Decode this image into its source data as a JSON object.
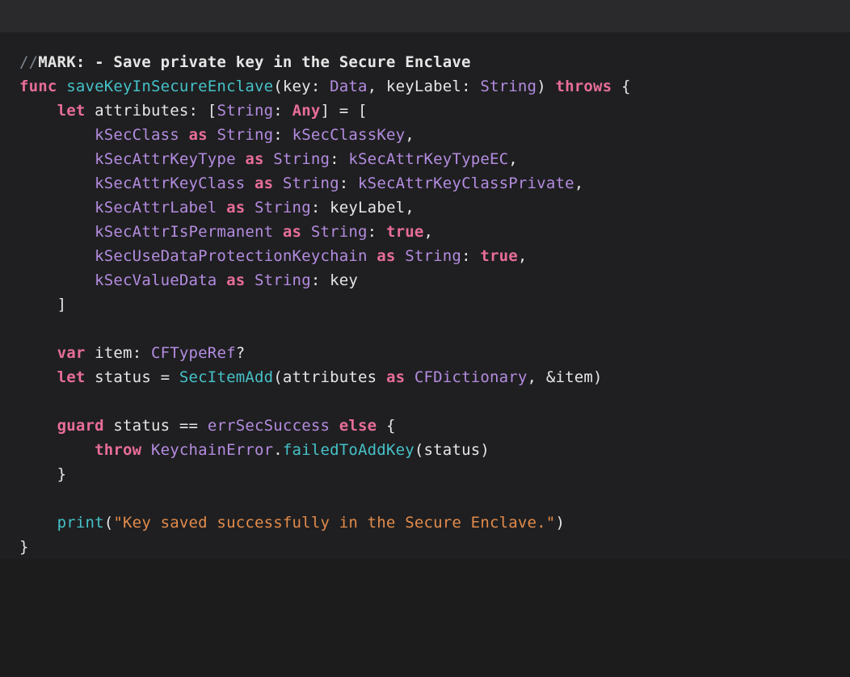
{
  "comment_prefix": "//",
  "comment_mark": "MARK: - Save private key in the Secure Enclave",
  "sig": {
    "func_kw": "func",
    "name": "saveKeyInSecureEnclave",
    "p1_name": "key",
    "p1_type": "Data",
    "p2_name": "keyLabel",
    "p2_type": "String",
    "throws_kw": "throws"
  },
  "attr": {
    "let_kw": "let",
    "var_name": "attributes",
    "dict_key_type": "String",
    "dict_val_type": "Any",
    "l1_k": "kSecClass",
    "l1_v": "kSecClassKey",
    "l2_k": "kSecAttrKeyType",
    "l2_v": "kSecAttrKeyTypeEC",
    "l3_k": "kSecAttrKeyClass",
    "l3_v": "kSecAttrKeyClassPrivate",
    "l4_k": "kSecAttrLabel",
    "l4_v": "keyLabel",
    "l5_k": "kSecAttrIsPermanent",
    "l5_v": "true",
    "l6_k": "kSecUseDataProtectionKeychain",
    "l6_v": "true",
    "l7_k": "kSecValueData",
    "l7_v": "key",
    "as_kw": "as",
    "string_t": "String"
  },
  "item": {
    "var_kw": "var",
    "name": "item",
    "type": "CFTypeRef",
    "opt": "?"
  },
  "status": {
    "let_kw": "let",
    "name": "status",
    "call": "SecItemAdd",
    "arg1": "attributes",
    "as_kw": "as",
    "cast_type": "CFDictionary",
    "arg2_amp": "&",
    "arg2": "item"
  },
  "guard_": {
    "guard_kw": "guard",
    "status": "status",
    "eqeq": "==",
    "err": "errSecSuccess",
    "else_kw": "else",
    "throw_kw": "throw",
    "err_type": "KeychainError",
    "dot": ".",
    "case_": "failedToAddKey",
    "arg": "status"
  },
  "print": {
    "call": "print",
    "msg": "\"Key saved successfully in the Secure Enclave.\""
  }
}
